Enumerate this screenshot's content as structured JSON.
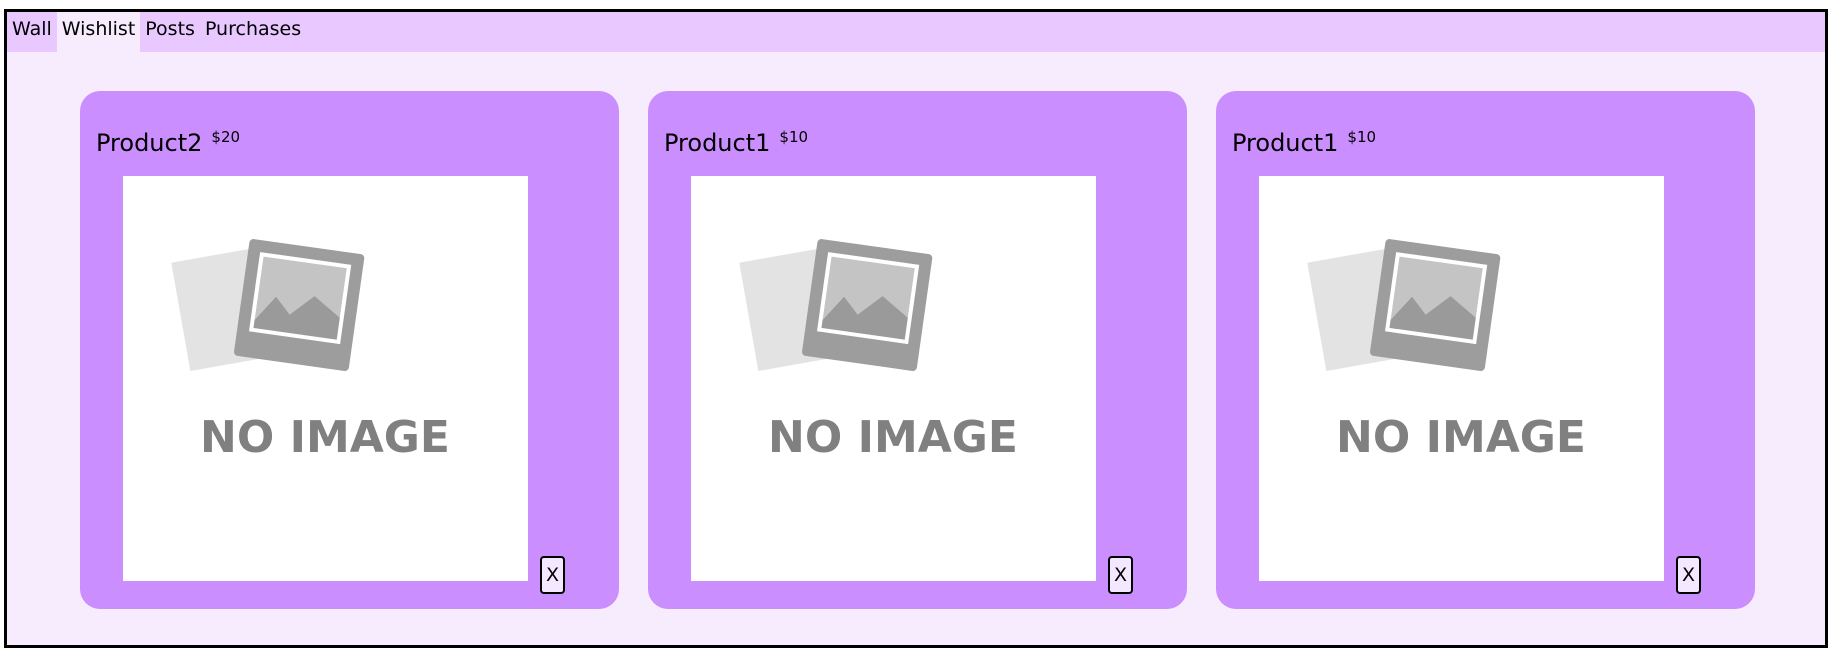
{
  "tabs": [
    {
      "label": "Wall",
      "active": false
    },
    {
      "label": "Wishlist",
      "active": true
    },
    {
      "label": "Posts",
      "active": false
    },
    {
      "label": "Purchases",
      "active": false
    }
  ],
  "wishlist": {
    "items": [
      {
        "name": "Product2",
        "price": "$20",
        "image_text": "NO IMAGE",
        "remove_label": "X"
      },
      {
        "name": "Product1",
        "price": "$10",
        "image_text": "NO IMAGE",
        "remove_label": "X"
      },
      {
        "name": "Product1",
        "price": "$10",
        "image_text": "NO IMAGE",
        "remove_label": "X"
      }
    ]
  },
  "colors": {
    "tab_bar": "#e8c8ff",
    "page_background": "#f6ecfd",
    "card_background": "#cb8efe",
    "placeholder_gray": "#808080"
  }
}
